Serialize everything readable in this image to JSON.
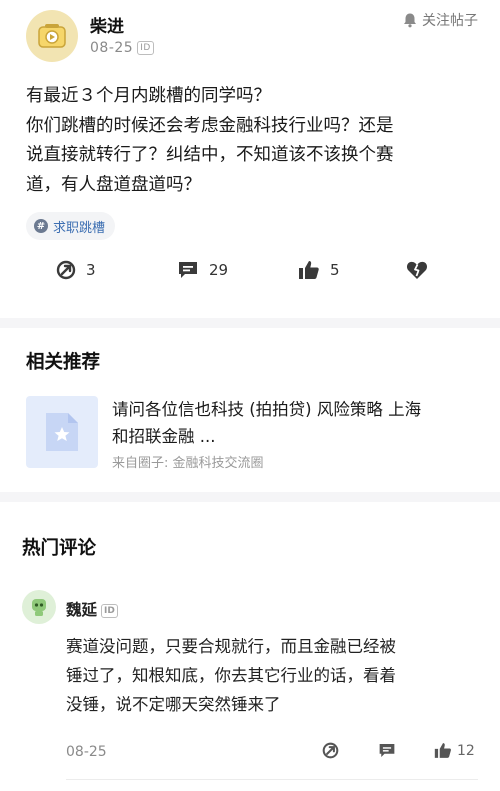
{
  "post": {
    "author": "柴进",
    "date": "08-25",
    "id_badge": "ID",
    "follow_label": "关注帖子",
    "content_lines": [
      "有最近３个月内跳槽的同学吗？",
      "你们跳槽的时候还会考虑金融科技行业吗？还是",
      "说直接就转行了？纠结中，不知道该不该换个赛",
      "道，有人盘道盘道吗？"
    ],
    "tag": "求职跳槽",
    "actions": {
      "share_count": "3",
      "comment_count": "29",
      "like_count": "5"
    }
  },
  "related": {
    "title": "相关推荐",
    "item": {
      "title_lines": [
        "请问各位信也科技 (拍拍贷) 风险策略 上海",
        "和招联金融 ..."
      ],
      "source": "来自圈子:  金融科技交流圈"
    }
  },
  "comments": {
    "title": "热门评论",
    "items": [
      {
        "author": "魏延",
        "id_badge": "ID",
        "text_lines": [
          "赛道没问题，只要合规就行，而且金融已经被",
          "锤过了，知根知底，你去其它行业的话，看着",
          "没锤，说不定哪天突然锤来了"
        ],
        "date": "08-25",
        "like_count": "12"
      }
    ]
  },
  "colors": {
    "tag_text": "#3d6fb2",
    "muted": "#8a8a8a",
    "separator": "#f5f5f7"
  }
}
